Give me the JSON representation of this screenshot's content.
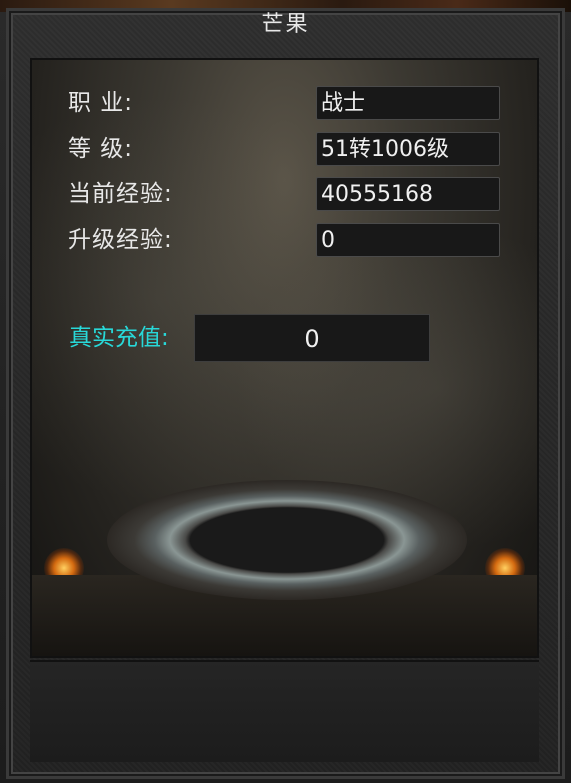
{
  "window": {
    "title": "芒果"
  },
  "stats": {
    "class_label": "职  业:",
    "class_value": "战士",
    "level_label": "等  级:",
    "level_value": "51转1006级",
    "current_exp_label": "当前经验:",
    "current_exp_value": "40555168",
    "upgrade_exp_label": "升级经验:",
    "upgrade_exp_value": "0"
  },
  "recharge": {
    "label": "真实充值:",
    "value": "0",
    "label_color": "#28d8d8"
  }
}
